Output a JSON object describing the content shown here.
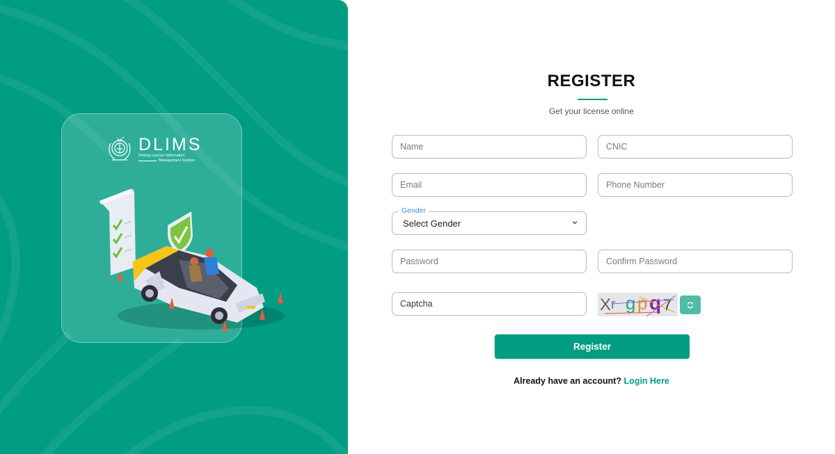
{
  "brand": {
    "name": "DLIMS",
    "tagline_line1": "Driving Licence Information",
    "tagline_line2": "Management System",
    "primary_color": "#019d82",
    "accent_blue": "#3d8fd6"
  },
  "form": {
    "title": "REGISTER",
    "subtitle": "Get your license online",
    "fields": {
      "name": {
        "placeholder": "Name",
        "value": ""
      },
      "cnic": {
        "placeholder": "CNIC",
        "value": ""
      },
      "email": {
        "placeholder": "Email",
        "value": ""
      },
      "phone": {
        "placeholder": "Phone Number",
        "value": ""
      },
      "password": {
        "placeholder": "Password",
        "value": ""
      },
      "confirm_password": {
        "placeholder": "Confirm Password",
        "value": ""
      },
      "captcha": {
        "placeholder": "Captcha",
        "value": ""
      }
    },
    "gender": {
      "label": "Gender",
      "selected": "Select Gender"
    },
    "captcha_image": {
      "text": "Xr gpq7",
      "chars": [
        "X",
        "r",
        "g",
        "p",
        "q",
        "7"
      ]
    },
    "refresh_icon": "refresh-icon",
    "submit_label": "Register",
    "login_prompt": "Already have an account?",
    "login_link": "Login Here"
  }
}
